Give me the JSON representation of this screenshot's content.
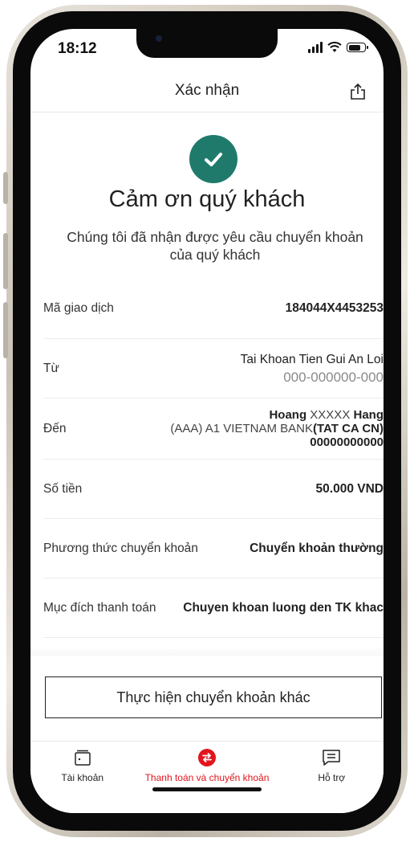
{
  "status": {
    "time": "18:12"
  },
  "header": {
    "title": "Xác nhận",
    "share_icon": "share-icon"
  },
  "success": {
    "icon": "check-circle-icon",
    "title": "Cảm ơn quý khách",
    "subtitle": "Chúng tôi đã nhận được yêu cầu chuyển khoản của quý khách"
  },
  "details": {
    "transaction_id": {
      "label": "Mã giao dịch",
      "value": "184044X4453253"
    },
    "from": {
      "label": "Từ",
      "account_name": "Tai Khoan Tien Gui An Loi",
      "account_number": "000-000000-000"
    },
    "to": {
      "label": "Đến",
      "name_first": "Hoang",
      "name_middle": "XXXXX",
      "name_last": "Hang",
      "bank": "(AAA) A1 VIETNAM BANK",
      "branch": "(TAT CA CN)",
      "account_number": "00000000000"
    },
    "amount": {
      "label": "Số tiền",
      "value": "50.000 VND"
    },
    "method": {
      "label": "Phương thức chuyển khoản",
      "value": "Chuyển khoản thường"
    },
    "purpose": {
      "label": "Mục đích thanh toán",
      "value": "Chuyen khoan luong den TK khac"
    }
  },
  "actions": {
    "new_transfer": "Thực hiện chuyển khoản khác"
  },
  "tabbar": {
    "items": [
      {
        "label": "Tài khoản",
        "icon": "wallet-icon"
      },
      {
        "label": "Thanh toán và chuyển khoản",
        "icon": "transfer-icon"
      },
      {
        "label": "Hỗ trợ",
        "icon": "chat-icon"
      }
    ],
    "active_color": "#e3141d"
  },
  "colors": {
    "success": "#1f7a6c",
    "accent": "#e3141d"
  }
}
